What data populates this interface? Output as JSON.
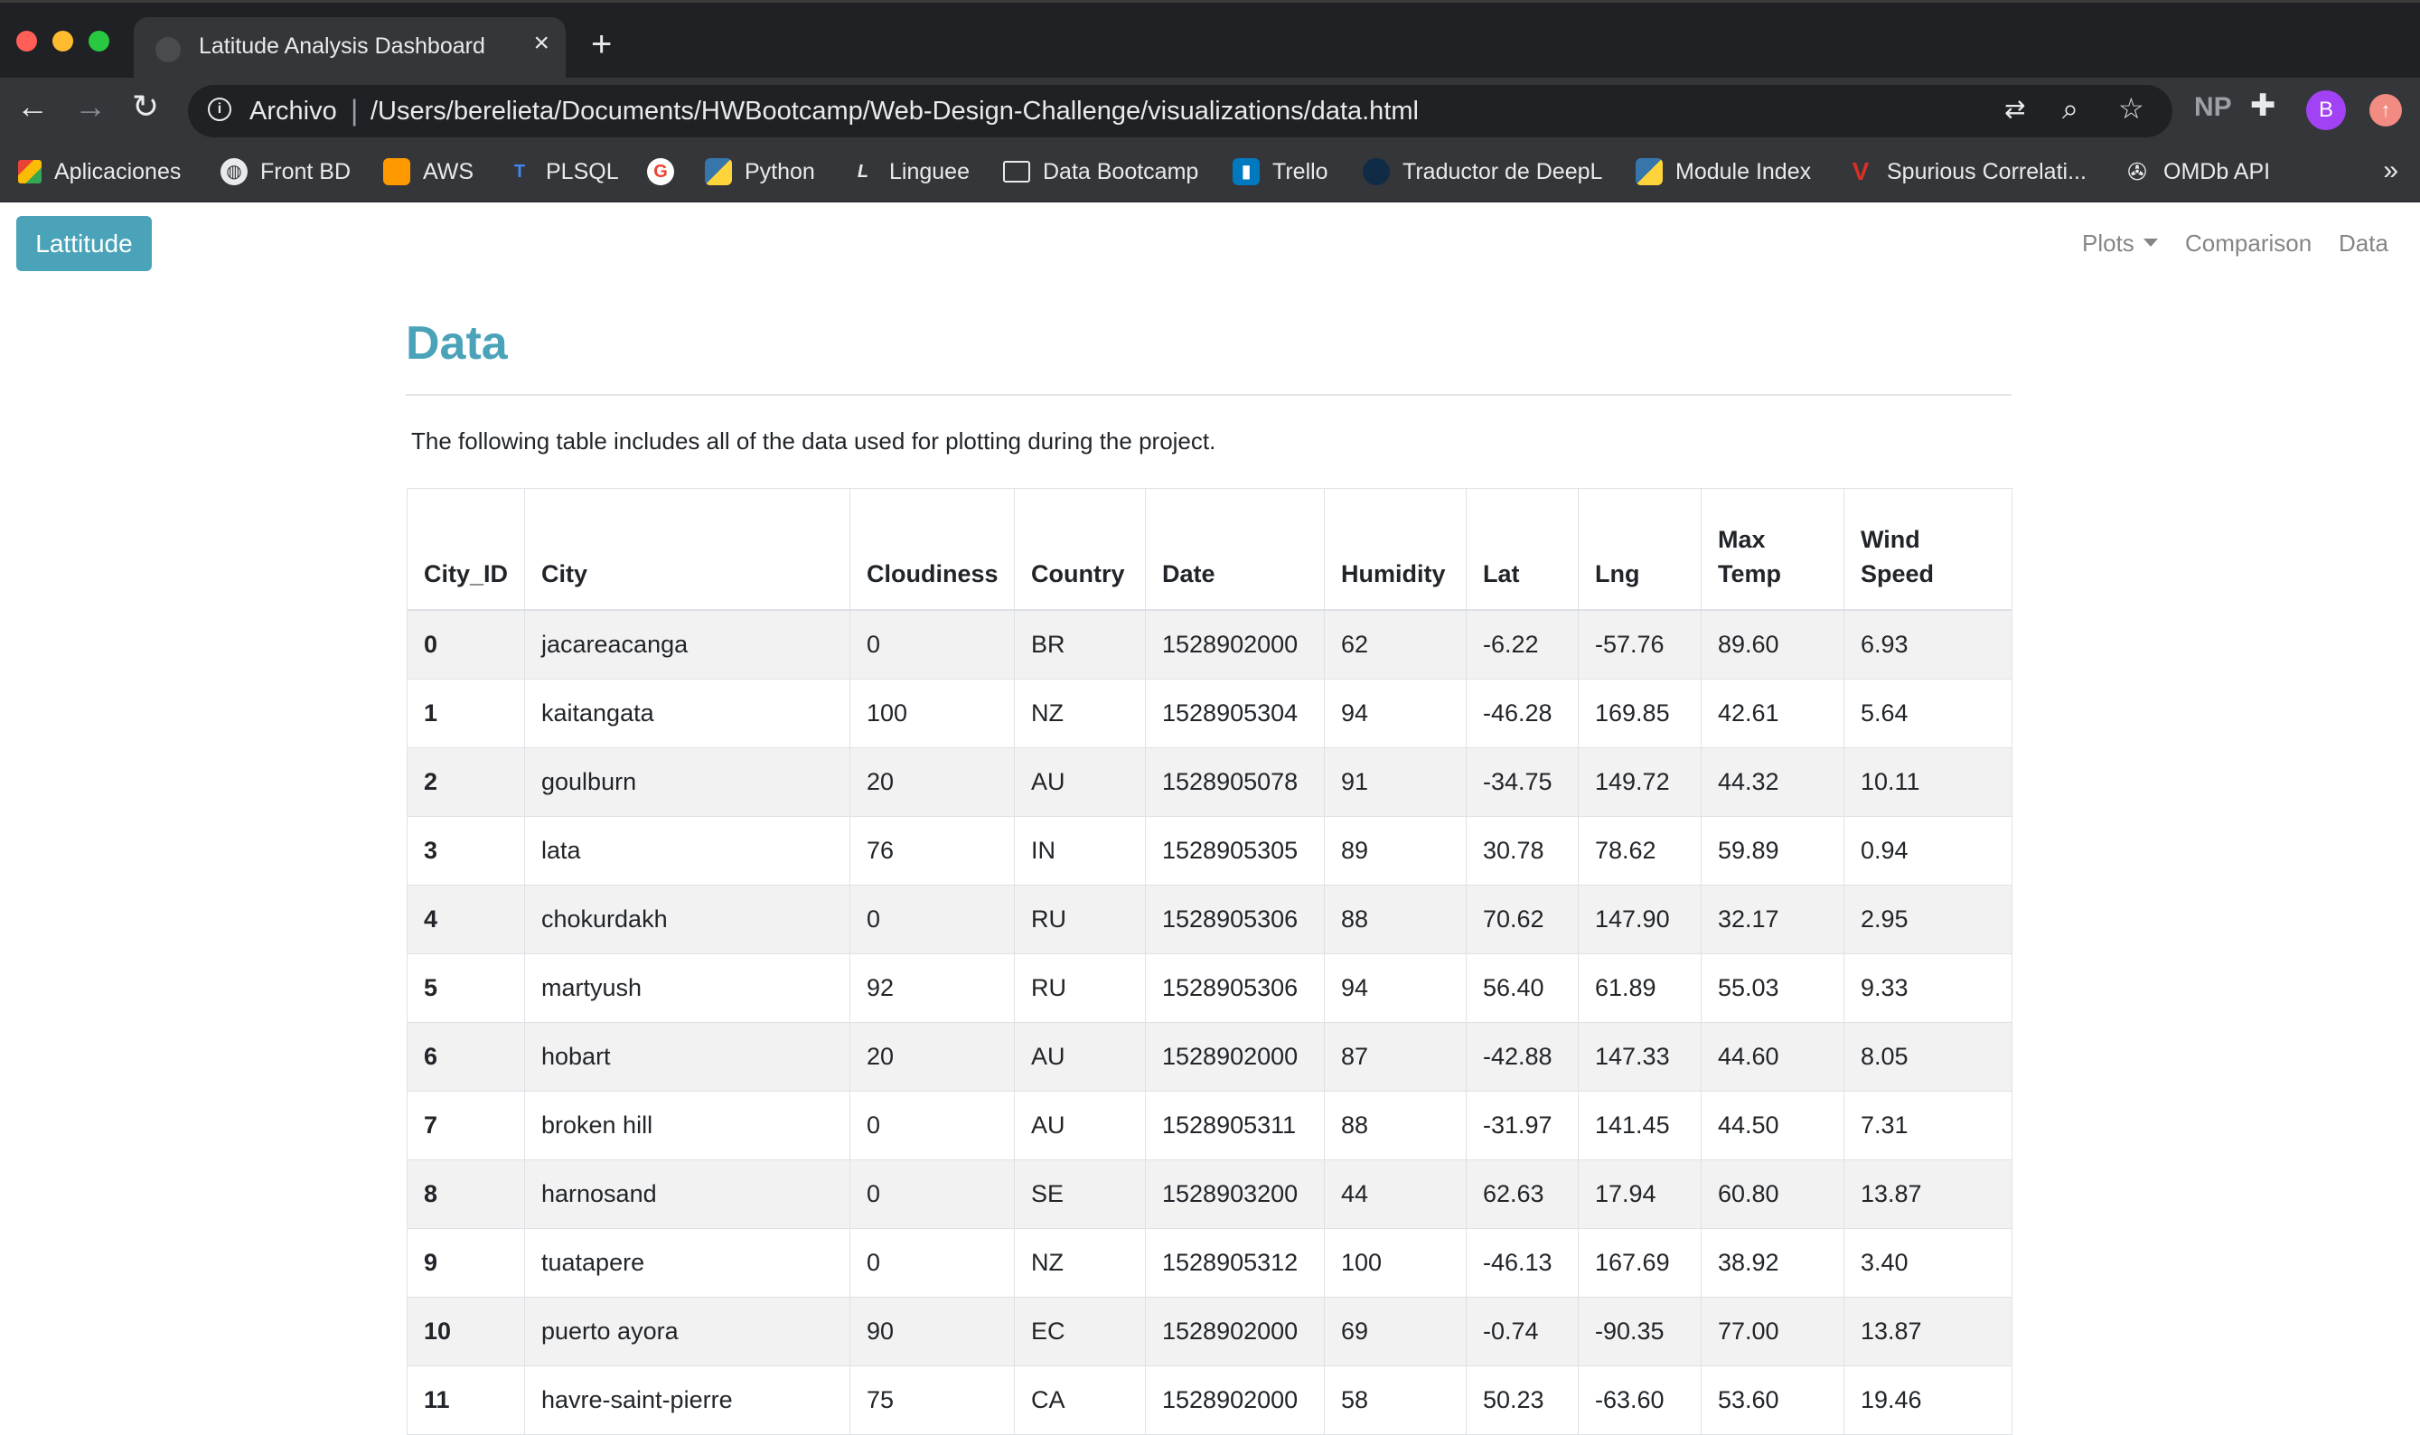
{
  "browser": {
    "tab_title": "Latitude Analysis Dashboard",
    "address_scheme": "Archivo",
    "address_url": "/Users/berelieta/Documents/HWBootcamp/Web-Design-Challenge/visualizations/data.html",
    "extension_label": "NP",
    "profile_initial": "B",
    "bookmarks": [
      {
        "label": "Aplicaciones",
        "icon": "apps-grid-icon"
      },
      {
        "label": "Front BD",
        "icon": "globe-icon"
      },
      {
        "label": "AWS",
        "icon": "aws-cube-icon"
      },
      {
        "label": "PLSQL",
        "icon": "plsql-icon"
      },
      {
        "label": "",
        "icon": "google-icon"
      },
      {
        "label": "Python",
        "icon": "python-icon"
      },
      {
        "label": "Linguee",
        "icon": "linguee-icon"
      },
      {
        "label": "Data Bootcamp",
        "icon": "folder-icon"
      },
      {
        "label": "Trello",
        "icon": "trello-icon"
      },
      {
        "label": "Traductor de DeepL",
        "icon": "deepl-icon"
      },
      {
        "label": "Module Index",
        "icon": "python-icon"
      },
      {
        "label": "Spurious Correlati...",
        "icon": "v-logo-icon"
      },
      {
        "label": "OMDb API",
        "icon": "film-reel-icon"
      }
    ],
    "bookmarks_more": "»"
  },
  "nav": {
    "brand": "Lattitude",
    "links": [
      "Plots",
      "Comparison",
      "Data"
    ]
  },
  "page": {
    "title": "Data",
    "intro": "The following table includes all of the data used for plotting during the project."
  },
  "table": {
    "headers": [
      "City_ID",
      "City",
      "Cloudiness",
      "Country",
      "Date",
      "Humidity",
      "Lat",
      "Lng",
      "Max Temp",
      "Wind Speed"
    ],
    "rows": [
      [
        "0",
        "jacareacanga",
        "0",
        "BR",
        "1528902000",
        "62",
        "-6.22",
        "-57.76",
        "89.60",
        "6.93"
      ],
      [
        "1",
        "kaitangata",
        "100",
        "NZ",
        "1528905304",
        "94",
        "-46.28",
        "169.85",
        "42.61",
        "5.64"
      ],
      [
        "2",
        "goulburn",
        "20",
        "AU",
        "1528905078",
        "91",
        "-34.75",
        "149.72",
        "44.32",
        "10.11"
      ],
      [
        "3",
        "lata",
        "76",
        "IN",
        "1528905305",
        "89",
        "30.78",
        "78.62",
        "59.89",
        "0.94"
      ],
      [
        "4",
        "chokurdakh",
        "0",
        "RU",
        "1528905306",
        "88",
        "70.62",
        "147.90",
        "32.17",
        "2.95"
      ],
      [
        "5",
        "martyush",
        "92",
        "RU",
        "1528905306",
        "94",
        "56.40",
        "61.89",
        "55.03",
        "9.33"
      ],
      [
        "6",
        "hobart",
        "20",
        "AU",
        "1528902000",
        "87",
        "-42.88",
        "147.33",
        "44.60",
        "8.05"
      ],
      [
        "7",
        "broken hill",
        "0",
        "AU",
        "1528905311",
        "88",
        "-31.97",
        "141.45",
        "44.50",
        "7.31"
      ],
      [
        "8",
        "harnosand",
        "0",
        "SE",
        "1528903200",
        "44",
        "62.63",
        "17.94",
        "60.80",
        "13.87"
      ],
      [
        "9",
        "tuatapere",
        "0",
        "NZ",
        "1528905312",
        "100",
        "-46.13",
        "167.69",
        "38.92",
        "3.40"
      ],
      [
        "10",
        "puerto ayora",
        "90",
        "EC",
        "1528902000",
        "69",
        "-0.74",
        "-90.35",
        "77.00",
        "13.87"
      ],
      [
        "11",
        "havre-saint-pierre",
        "75",
        "CA",
        "1528902000",
        "58",
        "50.23",
        "-63.60",
        "53.60",
        "19.46"
      ]
    ]
  }
}
